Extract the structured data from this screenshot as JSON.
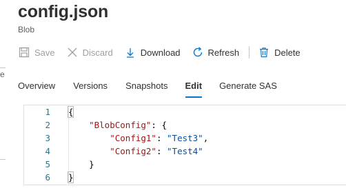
{
  "blade": {
    "title": "config.json",
    "subtitle": "Blob"
  },
  "toolbar": {
    "save_label": "Save",
    "discard_label": "Discard",
    "download_label": "Download",
    "refresh_label": "Refresh",
    "delete_label": "Delete"
  },
  "tabs": [
    {
      "label": "Overview"
    },
    {
      "label": "Versions"
    },
    {
      "label": "Snapshots"
    },
    {
      "label": "Edit",
      "active": true
    },
    {
      "label": "Generate SAS"
    }
  ],
  "left_panel": {
    "glyph": "e"
  },
  "editor": {
    "lines": [
      {
        "num": "1",
        "indent": "",
        "key": "",
        "sep": "",
        "value": "",
        "punct": "{"
      },
      {
        "num": "2",
        "indent": "    ",
        "key": "\"BlobConfig\"",
        "sep": ": ",
        "value": "",
        "punct": "{"
      },
      {
        "num": "3",
        "indent": "        ",
        "key": "\"Config1\"",
        "sep": ": ",
        "value": "\"Test3\"",
        "punct": ","
      },
      {
        "num": "4",
        "indent": "        ",
        "key": "\"Config2\"",
        "sep": ": ",
        "value": "\"Test4\"",
        "punct": ""
      },
      {
        "num": "5",
        "indent": "    ",
        "key": "",
        "sep": "",
        "value": "",
        "punct": "}"
      },
      {
        "num": "6",
        "indent": "",
        "key": "",
        "sep": "",
        "value": "",
        "punct": "}"
      }
    ]
  },
  "colors": {
    "accent": "#0078d4",
    "line_number": "#237893",
    "json_key": "#a31515",
    "json_string": "#0451a5",
    "disabled_text": "#a19f9d"
  }
}
